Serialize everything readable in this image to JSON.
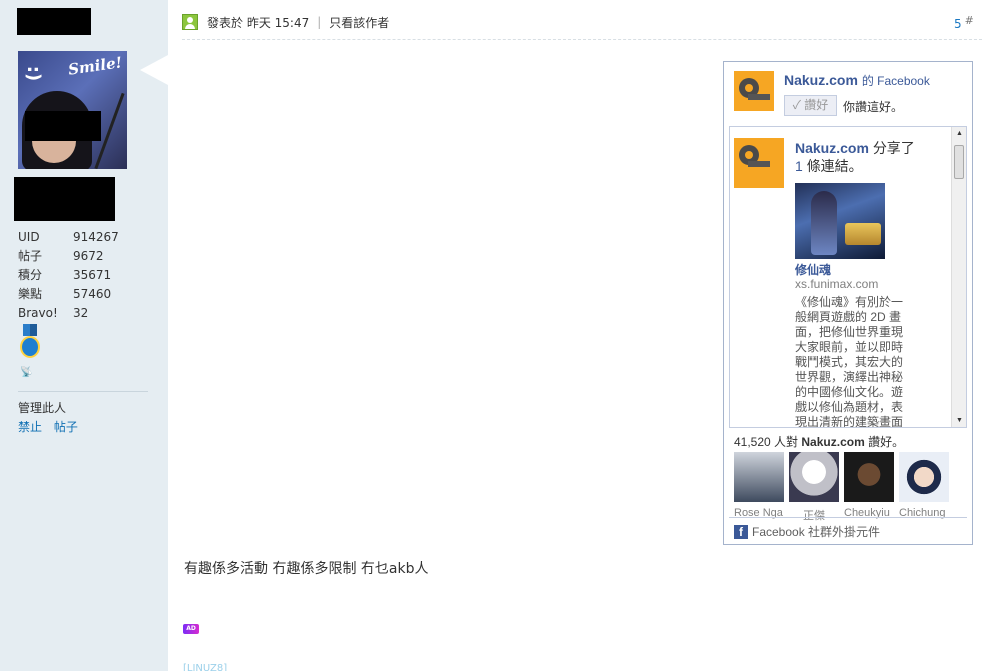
{
  "profile": {
    "stats": [
      {
        "key": "UID",
        "value": "914267"
      },
      {
        "key": "帖子",
        "value": "9672"
      },
      {
        "key": "積分",
        "value": "35671"
      },
      {
        "key": "樂點",
        "value": "57460"
      },
      {
        "key": "Bravo!",
        "value": "32"
      }
    ],
    "avatar_text": "Smile!",
    "avatar_emoticon": ":)",
    "manage_label": "管理此人",
    "manage_links": [
      "禁止",
      "帖子"
    ]
  },
  "post": {
    "posted_label": "發表於 昨天 15:47",
    "separator": "|",
    "author_only": "只看該作者",
    "floor_number": "5",
    "floor_symbol": "#",
    "message": "有趣係多活動 冇趣係多限制 冇乜akb人",
    "ad_badge": "AD",
    "cut_link": "[LINUZ8]"
  },
  "facebook": {
    "page_name": "Nakuz.com",
    "page_suffix": "的 Facebook",
    "like_button": "讚好",
    "like_status": "你讚這好。",
    "feed_post": {
      "author": "Nakuz.com",
      "action_prefix": "分享了",
      "count": "1",
      "action_suffix": "條連結。",
      "link_title": "修仙魂",
      "link_url": "xs.funimax.com",
      "link_desc": "《修仙魂》有別於一般網頁遊戲的 2D 畫面，把修仙世界重現大家眼前，並以即時戰鬥模式，其宏大的世界觀，演繹出神秘的中國修仙文化。遊戲以修仙為題材，表現出清新的建築畫面"
    },
    "like_count_prefix": "41,520 人對",
    "like_count_page": "Nakuz.com",
    "like_count_suffix": "讚好。",
    "faces": [
      {
        "name": "Rose Nga"
      },
      {
        "name": "正傑"
      },
      {
        "name": "Cheukyiu"
      },
      {
        "name": "Chichung"
      }
    ],
    "footer": "Facebook 社群外掛元件"
  },
  "colors": {
    "sidebar_bg": "#e5edf2",
    "link_blue": "#0f6fb3",
    "facebook_blue": "#3b5998",
    "brand_orange": "#f6a623"
  }
}
